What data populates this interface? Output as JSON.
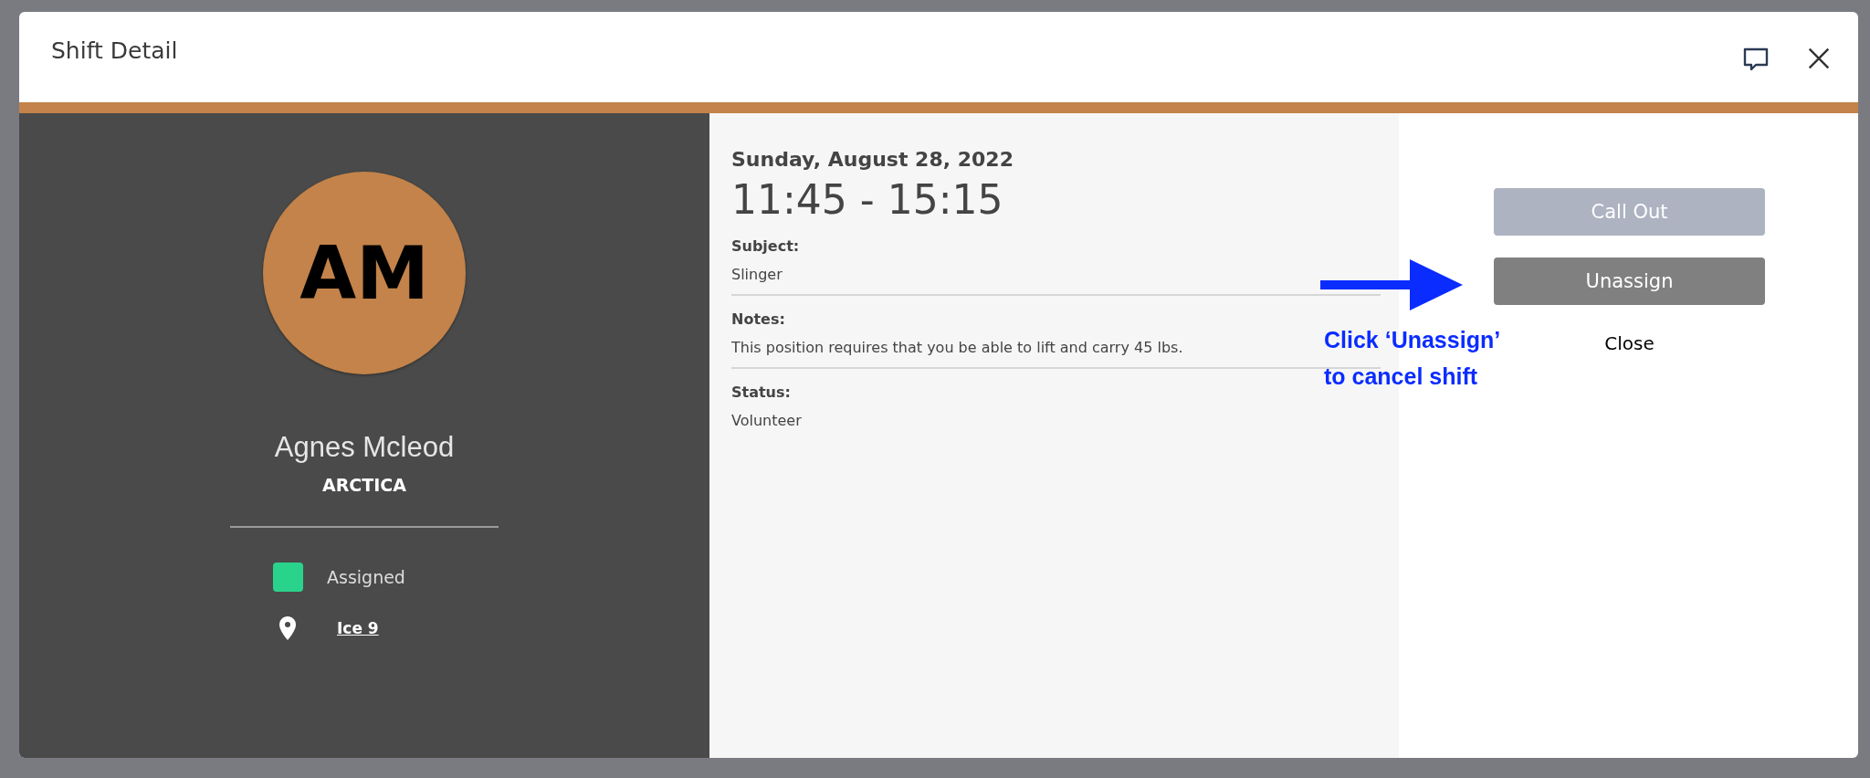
{
  "modal": {
    "title": "Shift Detail"
  },
  "person": {
    "initials": "AM",
    "name": "Agnes Mcleod",
    "organization": "ARCTICA",
    "status": {
      "label": "Assigned",
      "color": "#2ad38b"
    },
    "location": "Ice 9"
  },
  "shift": {
    "date": "Sunday, August 28, 2022",
    "time": "11:45 - 15:15",
    "fields": [
      {
        "label": "Subject:",
        "value": "Slinger"
      },
      {
        "label": "Notes:",
        "value": "This position requires that you be able to lift and carry 45 lbs."
      },
      {
        "label": "Status:",
        "value": "Volunteer"
      }
    ]
  },
  "actions": [
    {
      "label": "Call Out",
      "kind": "button",
      "disabled": true
    },
    {
      "label": "Unassign",
      "kind": "button",
      "disabled": false
    },
    {
      "label": "Close",
      "kind": "link",
      "disabled": false
    }
  ],
  "annotation": {
    "lines": [
      "Click ‘Unassign’",
      "to cancel shift"
    ]
  }
}
